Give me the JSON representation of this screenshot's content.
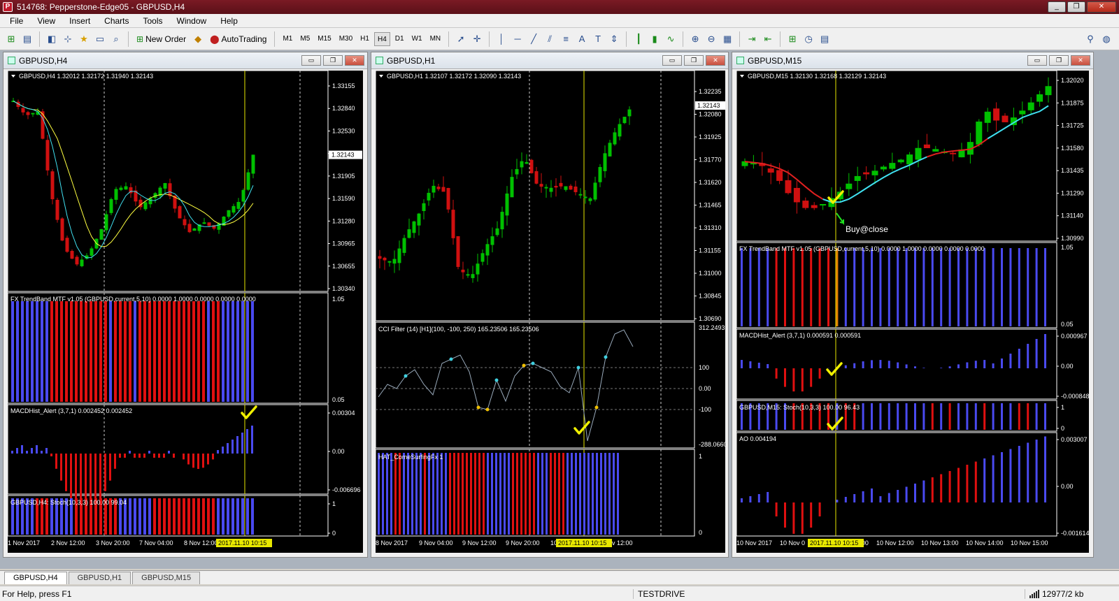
{
  "window": {
    "title": "514768: Pepperstone-Edge05 - GBPUSD,H4",
    "min": "0",
    "max": "1",
    "close": "r"
  },
  "menu": [
    "File",
    "View",
    "Insert",
    "Charts",
    "Tools",
    "Window",
    "Help"
  ],
  "toolbar": {
    "new_order": "New Order",
    "autotrading": "AutoTrading",
    "timeframes": [
      "M1",
      "M5",
      "M15",
      "M30",
      "H1",
      "H4",
      "D1",
      "W1",
      "MN"
    ],
    "active_timeframe": "H4"
  },
  "charts": [
    {
      "window_title": "GBPUSD,H4",
      "ohlc_label": "GBPUSD,H4  1.32012 1.32172 1.31940 1.32143",
      "price_ticks": [
        "1.33155",
        "1.32840",
        "1.32530",
        "1.32215",
        "1.31905",
        "1.31590",
        "1.31280",
        "1.30965",
        "1.30655",
        "1.30340"
      ],
      "current_price": "1.32143",
      "ind1_label": "FX TrendBand MTF v1.05 (GBPUSD,current,5,10) 0.0000 1.0000 0.0000 0.0000 0.0000",
      "ind1_max": "1.05",
      "ind1_min": "0.05",
      "ind2_label": "MACDHist_Alert (3,7,1)  0.002452 0.002452",
      "ind2_ticks": [
        "0.00304",
        "0.00",
        "-0.006696"
      ],
      "ind3_label": "GBPUSD,H4: Stoch(10,3,3) 100.00 99.04",
      "ind3_ticks": [
        "1",
        "0"
      ],
      "time_labels": [
        "1 Nov 2017",
        "2 Nov 12:00",
        "3 Nov 20:00",
        "7 Nov 04:00",
        "8 Nov 12:00"
      ],
      "time_highlight": "2017.11.10 10:15"
    },
    {
      "window_title": "GBPUSD,H1",
      "ohlc_label": "GBPUSD,H1  1.32107 1.32172 1.32090 1.32143",
      "price_ticks": [
        "1.32235",
        "1.32080",
        "1.31925",
        "1.31770",
        "1.31620",
        "1.31465",
        "1.31310",
        "1.31155",
        "1.31000",
        "1.30845",
        "1.30690"
      ],
      "current_price": "1.32143",
      "ind1_label": "CCI Filter (14) [H1](100, -100, 250) 165.23506 165.23506",
      "ind1_ticks": [
        "312.2493",
        "100",
        "0.00",
        "-100",
        "-288.0660"
      ],
      "ind2_label": "HAT_ComeSurfingFx 1",
      "ind2_ticks": [
        "1",
        "0"
      ],
      "time_labels": [
        "8 Nov 2017",
        "9 Nov 04:00",
        "9 Nov 12:00",
        "9 Nov 20:00",
        "10"
      ],
      "time_tail": "v 12:00",
      "time_highlight": "2017.11.10 10:15"
    },
    {
      "window_title": "GBPUSD,M15",
      "ohlc_label": "GBPUSD,M15  1.32130 1.32168 1.32129 1.32143",
      "price_ticks": [
        "1.32020",
        "1.31875",
        "1.31725",
        "1.31580",
        "1.31435",
        "1.31290",
        "1.31140",
        "1.30990"
      ],
      "annotation": "Buy@close",
      "ind1_label": "FX TrendBand MTF v1.05 (GBPUSD,current,5,10) 0.0000 1.0000 0.0000 0.0000 0.0000",
      "ind1_max": "1.05",
      "ind1_min": "0.05",
      "ind2_label": "MACDHist_Alert (3,7,1)  0.000591 0.000591",
      "ind2_ticks": [
        "0.000967",
        "0.00",
        "-0.000848"
      ],
      "ind3_label": "GBPUSD,M15: Stoch(10,3,3) 100.00 96.43",
      "ind3_ticks": [
        "1",
        "0"
      ],
      "ind4_label": "AO 0.004194",
      "ind4_ticks": [
        "0.003007",
        "0.00",
        "-0.001614"
      ],
      "time_labels": [
        "10 Nov 2017",
        "10 Nov 0",
        "10 Nov 11:00",
        "10 Nov 12:00",
        "10 Nov 13:00",
        "10 Nov 14:00",
        "10 Nov 15:00"
      ],
      "time_highlight": "2017.11.10 10:15"
    }
  ],
  "tabs": [
    "GBPUSD,H4",
    "GBPUSD,H1",
    "GBPUSD,M15"
  ],
  "active_tab": "GBPUSD,H4",
  "status": {
    "help": "For Help, press F1",
    "profile": "TESTDRIVE",
    "traffic": "12977/2 kb"
  },
  "colors": {
    "bull": "#00c000",
    "bear": "#d01010",
    "blue_bar": "#4a4af0",
    "red_bar": "#e01010",
    "vline": "#e8e800",
    "ma_yellow": "#ffff40",
    "ma_cyan": "#40e0f0",
    "check": "#f0f000"
  }
}
